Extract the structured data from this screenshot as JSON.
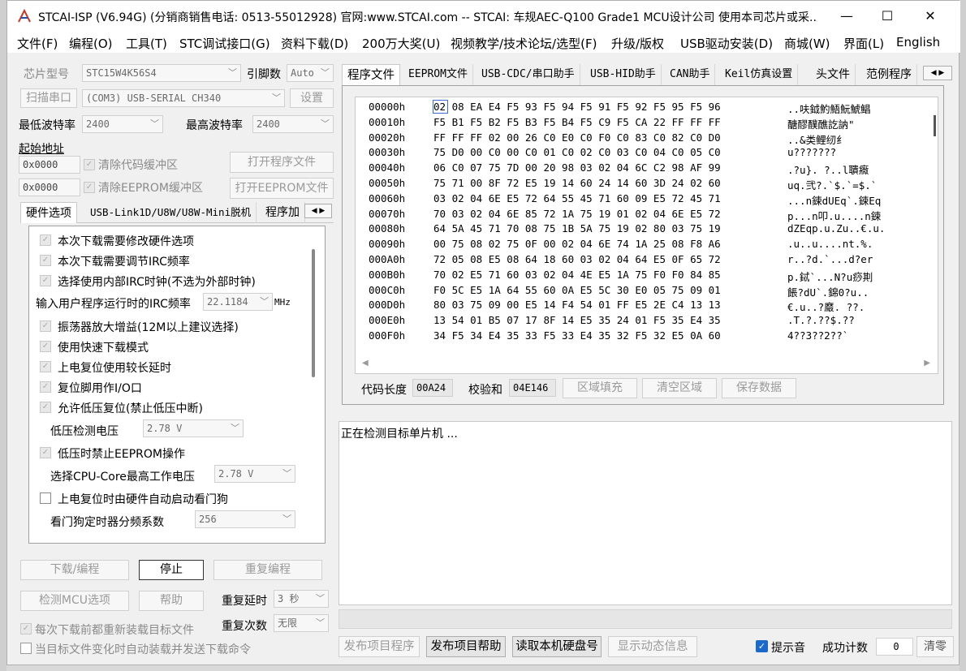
{
  "window": {
    "title": "STCAI-ISP (V6.94G) (分销商销售电话: 0513-55012928) 官网:www.STCAI.com  -- STCAI: 车规AEC-Q100 Grade1 MCU设计公司 使用本司芯片或采...",
    "min": "—",
    "max": "☐",
    "close": "✕"
  },
  "menu": [
    "文件(F)",
    "编程(O)",
    "工具(T)",
    "STC调试接口(G)",
    "资料下载(D)",
    "200万大奖(U)",
    "视频教学/技术论坛/选型(F)",
    "升级/版权",
    "USB驱动安装(D)",
    "商城(W)",
    "界面(L)",
    "English"
  ],
  "left": {
    "chip_label": "芯片型号",
    "chip_value": "STC15W4K56S4",
    "pins_label": "引脚数",
    "pins_value": "Auto",
    "scan_port": "扫描串口",
    "port_value": "(COM3) USB-SERIAL CH340",
    "settings": "设置",
    "min_baud_label": "最低波特率",
    "min_baud": "2400",
    "max_baud_label": "最高波特率",
    "max_baud": "2400",
    "start_addr": "起始地址",
    "addr1": "0x0000",
    "clear_code": "清除代码缓冲区",
    "open_prog": "打开程序文件",
    "addr2": "0x0000",
    "clear_eeprom": "清除EEPROM缓冲区",
    "open_eeprom": "打开EEPROM文件",
    "tabs": [
      "硬件选项",
      "USB-Link1D/U8W/U8W-Mini脱机",
      "程序加"
    ],
    "options": [
      {
        "text": "本次下载需要修改硬件选项",
        "checked": true
      },
      {
        "text": "本次下载需要调节IRC频率",
        "checked": true
      },
      {
        "text": "选择使用内部IRC时钟(不选为外部时钟)",
        "checked": true
      }
    ],
    "irc_label": "输入用户程序运行时的IRC频率",
    "irc_value": "22.1184",
    "irc_unit": "MHz",
    "options2": [
      {
        "text": "振荡器放大增益(12M以上建议选择)",
        "checked": true
      },
      {
        "text": "使用快速下载模式",
        "checked": true
      },
      {
        "text": "上电复位使用较长延时",
        "checked": true
      },
      {
        "text": "复位脚用作I/O口",
        "checked": true
      },
      {
        "text": "允许低压复位(禁止低压中断)",
        "checked": true
      }
    ],
    "lvd_label": "低压检测电压",
    "lvd_value": "2.78 V",
    "eeprom_lv": "低压时禁止EEPROM操作",
    "cpu_label": "选择CPU-Core最高工作电压",
    "cpu_value": "2.78 V",
    "wdt": "上电复位时由硬件自动启动看门狗",
    "wdt_div_label": "看门狗定时器分频系数",
    "wdt_div": "256",
    "download": "下载/编程",
    "stop": "停止",
    "reprogram": "重复编程",
    "detect": "检测MCU选项",
    "help": "帮助",
    "delay_label": "重复延时",
    "delay_value": "3 秒",
    "count_label": "重复次数",
    "count_value": "无限",
    "reload": "每次下载前都重新装载目标文件",
    "autoload": "当目标文件变化时自动装载并发送下载命令"
  },
  "right": {
    "tabs": [
      "程序文件",
      "EEPROM文件",
      "USB-CDC/串口助手",
      "USB-HID助手",
      "CAN助手",
      "Keil仿真设置",
      "头文件",
      "范例程序"
    ],
    "hex": [
      {
        "addr": "00000h",
        "bytes": "02 08 EA E4 F5 93 F5 94 F5 91 F5 92 F5 95 F5 96",
        "ascii": "..呋鉞魡鯃魭鯱鲳"
      },
      {
        "addr": "00010h",
        "bytes": "F5 B1 F5 B2 F5 B3 F5 B4 F5 C9 F5 CA 22 FF FF FF",
        "ascii": "醣醪醭醮訖訥\""
      },
      {
        "addr": "00020h",
        "bytes": "FF FF FF 02 00 26 C0 E0 C0 F0 C0 83 C0 82 C0 D0",
        "ascii": "      ..&类鲤纫纟"
      },
      {
        "addr": "00030h",
        "bytes": "75 D0 00 C0 00 C0 01 C0 02 C0 03 C0 04 C0 05 C0",
        "ascii": "u???????"
      },
      {
        "addr": "00040h",
        "bytes": "06 C0 07 75 7D 00 20 98 03 02 04 6C C2 98 AF 99",
        "ascii": ".?u}. ?..l聵癓"
      },
      {
        "addr": "00050h",
        "bytes": "75 71 00 8F 72 E5 19 14 60 24 14 60 3D 24 02 60",
        "ascii": "uq.弐?.`$.`=$.`"
      },
      {
        "addr": "00060h",
        "bytes": "03 02 04 6E E5 72 64 55 45 71 60 09 E5 72 45 71",
        "ascii": "...n鋉dUEq`.鋉Eq"
      },
      {
        "addr": "00070h",
        "bytes": "70 03 02 04 6E 85 72 1A 75 19 01 02 04 6E E5 72",
        "ascii": "p...n叩.u....n鋉"
      },
      {
        "addr": "00080h",
        "bytes": "64 5A 45 71 70 08 75 1B 5A 75 19 02 80 03 75 19",
        "ascii": "dZEqp.u.Zu..€.u."
      },
      {
        "addr": "00090h",
        "bytes": "00 75 08 02 75 0F 00 02 04 6E 74 1A 25 08 F8 A6",
        "ascii": ".u..u....nt.%."
      },
      {
        "addr": "000A0h",
        "bytes": "72 05 08 E5 08 64 18 60 03 02 04 64 E5 0F 65 72",
        "ascii": "r..?d.`...d?er"
      },
      {
        "addr": "000B0h",
        "bytes": "70 02 E5 71 60 03 02 04 4E E5 1A 75 F0 F0 84 85",
        "ascii": "p.鋱`...N?u痧剘"
      },
      {
        "addr": "000C0h",
        "bytes": "F0 5C E5 1A 64 55 60 0A E5 5C 30 E0 05 75 09 01",
        "ascii": "餦?dU`.錦0?u.."
      },
      {
        "addr": "000D0h",
        "bytes": "80 03 75 09 00 E5 14 F4 54 01 FF E5 2E C4 13 13",
        "ascii": "€.u..?黀.  ??."
      },
      {
        "addr": "000E0h",
        "bytes": "13 54 01 B5 07 17 8F 14 E5 35 24 01 F5 35 E4 35",
        "ascii": ".T.?.??$.??"
      },
      {
        "addr": "000F0h",
        "bytes": "34 F5 34 E4 35 33 F5 33 E4 35 32 F5 32 E5 0A 60",
        "ascii": "4??3??2??`"
      }
    ],
    "code_len_label": "代码长度",
    "code_len": "00A24",
    "checksum_label": "校验和",
    "checksum": "04E146",
    "fill": "区域填充",
    "clear_area": "清空区域",
    "save_data": "保存数据",
    "log": "正在检测目标单片机 ...",
    "publish_prog": "发布项目程序",
    "publish_help": "发布项目帮助",
    "read_disk": "读取本机硬盘号",
    "show_dyn": "显示动态信息",
    "sound": "提示音",
    "success_label": "成功计数",
    "success_value": "0",
    "clear": "清零"
  }
}
